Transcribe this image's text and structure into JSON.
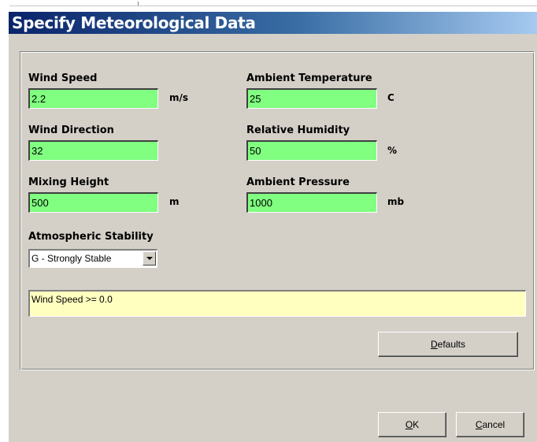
{
  "window": {
    "title": "Specify Meteorological Data"
  },
  "fields": {
    "wind_speed": {
      "label": "Wind Speed",
      "value": "2.2",
      "unit": "m/s"
    },
    "wind_direction": {
      "label": "Wind Direction",
      "value": "32"
    },
    "mixing_height": {
      "label": "Mixing Height",
      "value": "500",
      "unit": "m"
    },
    "ambient_temperature": {
      "label": "Ambient Temperature",
      "value": "25",
      "unit": "C"
    },
    "relative_humidity": {
      "label": "Relative Humidity",
      "value": "50",
      "unit": "%"
    },
    "ambient_pressure": {
      "label": "Ambient Pressure",
      "value": "1000",
      "unit": "mb"
    }
  },
  "stability": {
    "label": "Atmospheric Stability",
    "selected": "G - Strongly Stable"
  },
  "message": "Wind Speed >= 0.0",
  "buttons": {
    "defaults": {
      "mnemonic": "D",
      "rest": "efaults"
    },
    "ok": {
      "mnemonic": "O",
      "rest": "K"
    },
    "cancel": {
      "mnemonic": "C",
      "rest": "ancel"
    }
  },
  "colors": {
    "field_bg": "#80ff80",
    "message_bg": "#ffffc0",
    "dialog_bg": "#d4d0c8",
    "title_start": "#0a246a"
  }
}
